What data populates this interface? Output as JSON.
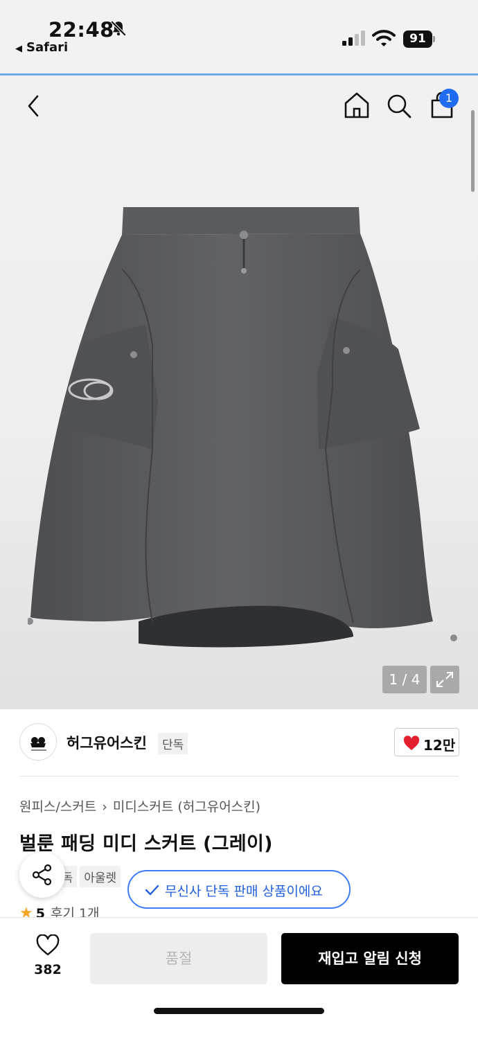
{
  "status_bar": {
    "time": "22:48",
    "back_app": "Safari",
    "battery": "91",
    "icons": [
      "bell-slash-icon",
      "signal-icon",
      "wifi-icon",
      "battery-icon"
    ]
  },
  "nav": {
    "icons": [
      "back-chevron-icon",
      "home-icon",
      "search-icon",
      "shopping-bag-icon"
    ],
    "cart_count": "1"
  },
  "gallery": {
    "pager": "1 / 4",
    "expand_icon": "expand-icon"
  },
  "brand": {
    "name": "허그유어스킨",
    "tag": "단독",
    "likes": "12만",
    "like_icon": "heart-icon",
    "heart_color": "#e5202e"
  },
  "breadcrumb": {
    "category": "원피스/스커트",
    "subcategory": "미디스커트 (허그유어스킨)"
  },
  "product": {
    "title": "벌룬 패딩 미디 스커트 (그레이)",
    "tags": [
      "단독",
      "아울렛"
    ],
    "notice": "무신사 단독 판매 상품이에요",
    "rating": "5",
    "review_count": "후기 1개"
  },
  "bottom_bar": {
    "wish_count": "382",
    "soldout_label": "품절",
    "restock_label": "재입고 알림 신청"
  },
  "colors": {
    "accent_blue": "#1f6cf0",
    "notice_blue": "#3b7cf4",
    "star": "#f5a623",
    "primary_button": "#000000"
  }
}
